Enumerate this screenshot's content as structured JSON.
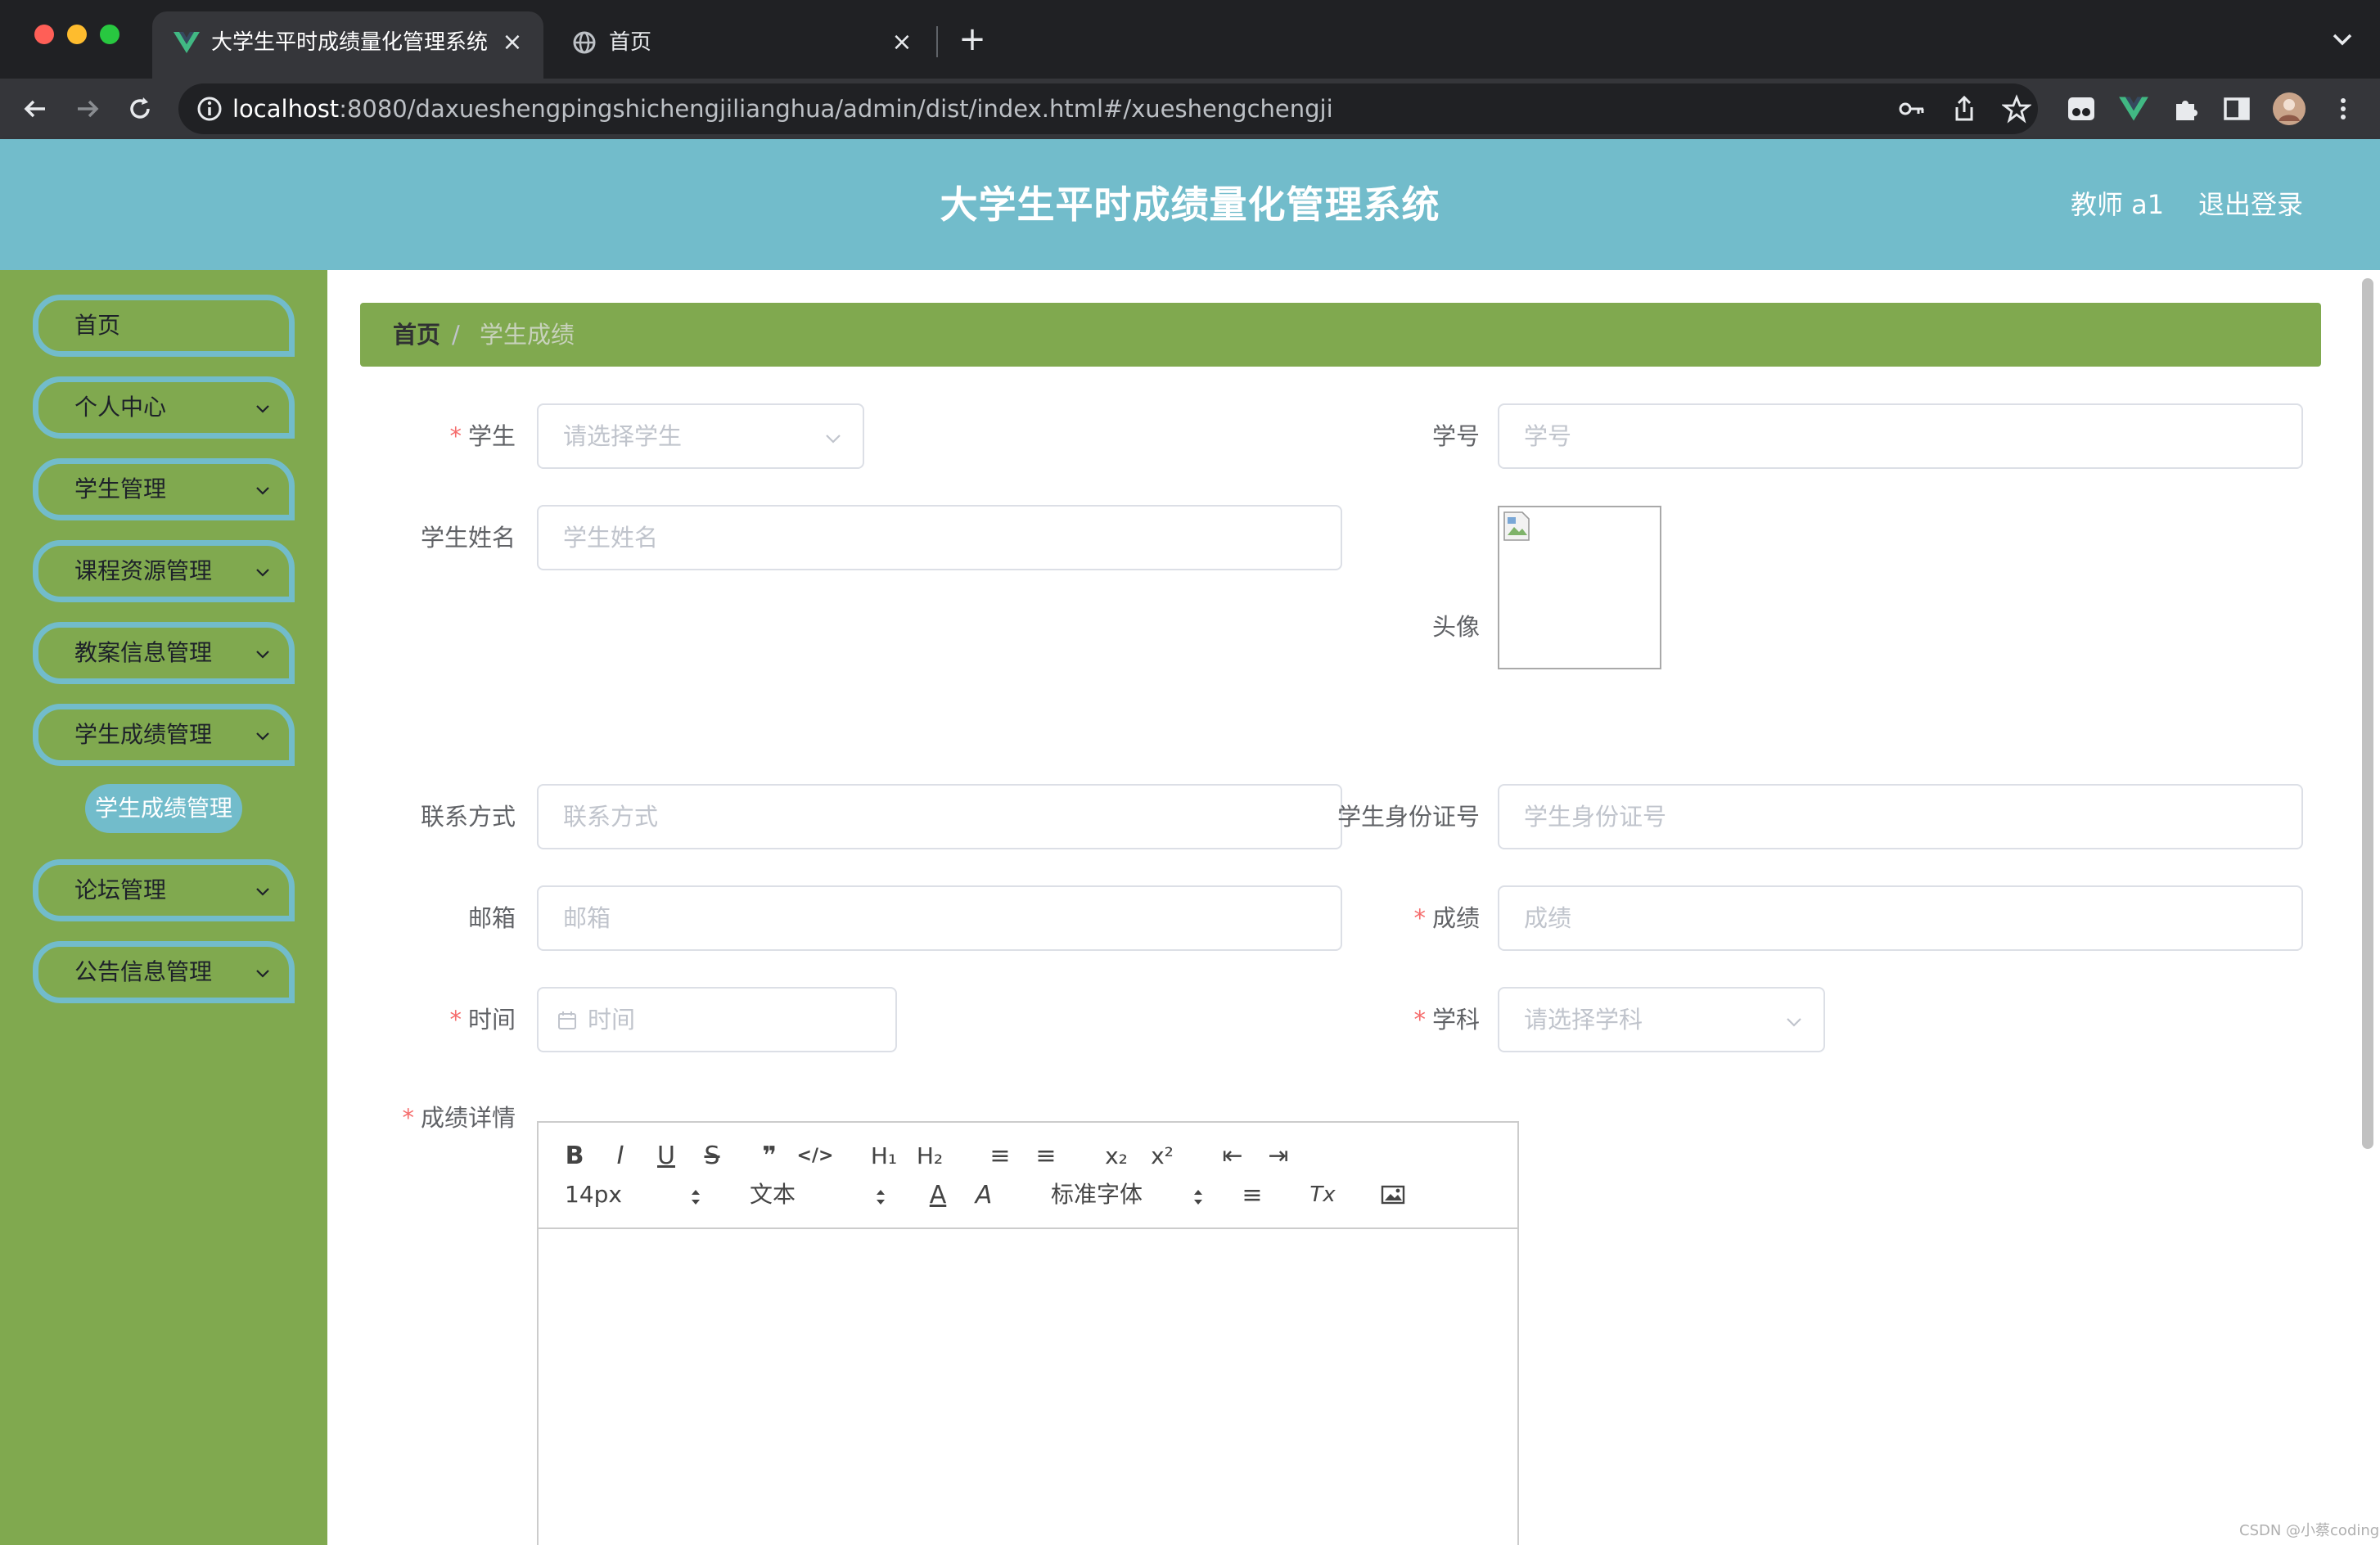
{
  "browser": {
    "active_tab": {
      "title": "大学生平时成绩量化管理系统",
      "icon": "vue-logo-icon"
    },
    "inactive_tab": {
      "title": "首页",
      "icon": "globe-icon"
    },
    "close_glyph": "×",
    "new_tab_glyph": "+",
    "url_host": "localhost",
    "url_rest": ":8080/daxueshengpingshichengjilianghua/admin/dist/index.html#/xueshengchengji"
  },
  "header": {
    "title": "大学生平时成绩量化管理系统",
    "user_label": "教师 a1",
    "logout_label": "退出登录"
  },
  "sidebar": {
    "items": [
      {
        "label": "首页",
        "has_submenu": false
      },
      {
        "label": "个人中心",
        "has_submenu": true
      },
      {
        "label": "学生管理",
        "has_submenu": true
      },
      {
        "label": "课程资源管理",
        "has_submenu": true
      },
      {
        "label": "教案信息管理",
        "has_submenu": true
      },
      {
        "label": "学生成绩管理",
        "has_submenu": true,
        "expanded": true
      },
      {
        "label": "论坛管理",
        "has_submenu": true
      },
      {
        "label": "公告信息管理",
        "has_submenu": true
      }
    ],
    "active_submenu_item": "学生成绩管理"
  },
  "breadcrumb": {
    "home": "首页",
    "separator": "/",
    "current": "学生成绩"
  },
  "form": {
    "student": {
      "label": "学生",
      "required": true,
      "placeholder": "请选择学生"
    },
    "student_no": {
      "label": "学号",
      "required": false,
      "placeholder": "学号"
    },
    "student_name": {
      "label": "学生姓名",
      "required": false,
      "placeholder": "学生姓名"
    },
    "avatar": {
      "label": "头像",
      "required": false
    },
    "contact": {
      "label": "联系方式",
      "required": false,
      "placeholder": "联系方式"
    },
    "id_card": {
      "label": "学生身份证号",
      "required": false,
      "placeholder": "学生身份证号"
    },
    "email": {
      "label": "邮箱",
      "required": false,
      "placeholder": "邮箱"
    },
    "score": {
      "label": "成绩",
      "required": true,
      "placeholder": "成绩"
    },
    "time": {
      "label": "时间",
      "required": true,
      "placeholder": "时间"
    },
    "subject": {
      "label": "学科",
      "required": true,
      "placeholder": "请选择学科"
    },
    "details": {
      "label": "成绩详情",
      "required": true
    },
    "required_mark": "*"
  },
  "editor": {
    "row1": [
      {
        "name": "bold-button",
        "glyph": "B"
      },
      {
        "name": "italic-button",
        "glyph": "I"
      },
      {
        "name": "underline-button",
        "glyph": "U"
      },
      {
        "name": "strike-button",
        "glyph": "S"
      },
      {
        "name": "blockquote-button",
        "glyph": "❞"
      },
      {
        "name": "code-block-button",
        "glyph": "</>"
      },
      {
        "name": "header1-button",
        "glyph": "H₁"
      },
      {
        "name": "header2-button",
        "glyph": "H₂"
      },
      {
        "name": "ordered-list-button",
        "glyph": "≡"
      },
      {
        "name": "bullet-list-button",
        "glyph": "≡"
      },
      {
        "name": "subscript-button",
        "glyph": "x₂"
      },
      {
        "name": "superscript-button",
        "glyph": "x²"
      },
      {
        "name": "outdent-button",
        "glyph": "⇤"
      },
      {
        "name": "indent-button",
        "glyph": "⇥"
      }
    ],
    "size_value": "14px",
    "heading_value": "文本",
    "font_value": "标准字体",
    "color_glyph": "A",
    "background_glyph": "A",
    "align_glyph": "≡",
    "clean_glyph": "Tx"
  },
  "colors": {
    "header": "#72bccb",
    "sidebar": "#80a94f",
    "breadcrumb": "#80a94f",
    "accent_pill": "#72bccb",
    "required": "#f56c6c"
  },
  "watermark": "CSDN @小蔡coding"
}
